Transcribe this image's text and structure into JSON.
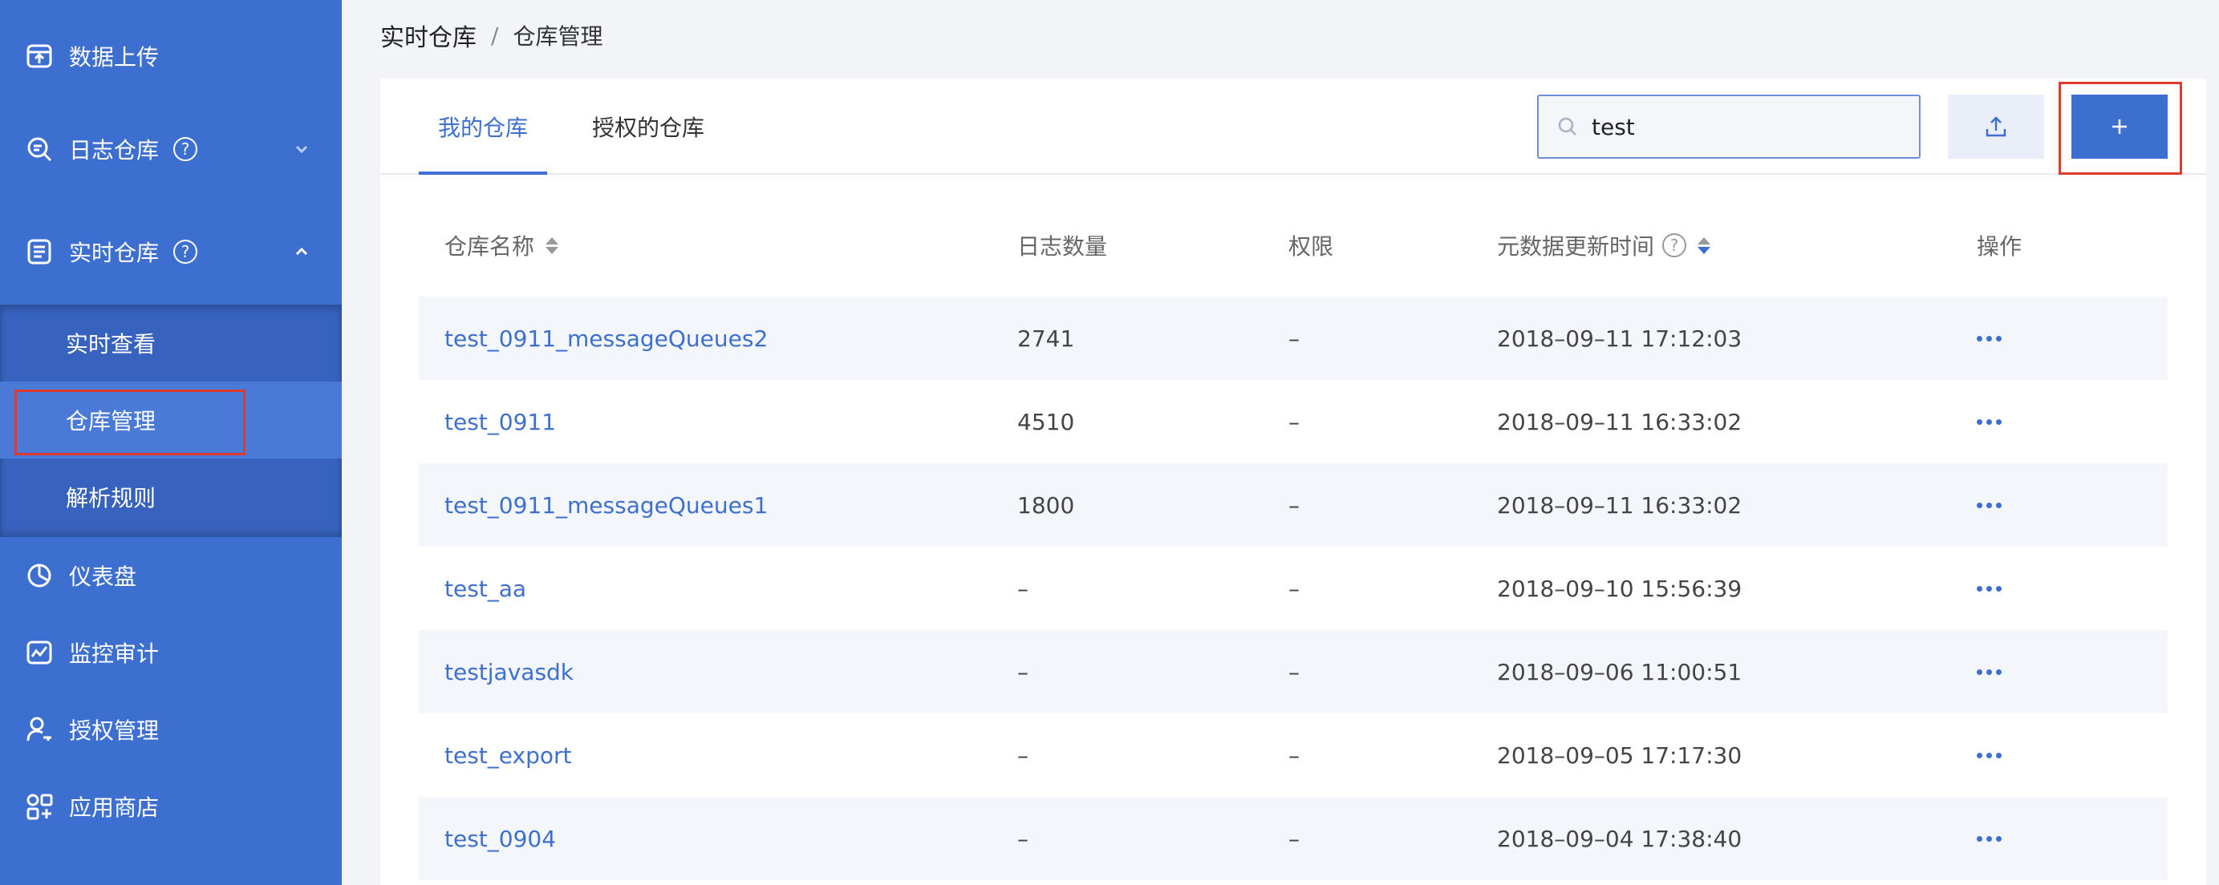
{
  "sidebar": {
    "items": [
      {
        "label": "数据上传",
        "icon": "upload-doc-icon"
      },
      {
        "label": "日志仓库",
        "icon": "log-search-icon",
        "help": "?"
      },
      {
        "label": "实时仓库",
        "icon": "list-doc-icon",
        "help": "?"
      },
      {
        "label": "仪表盘",
        "icon": "pie-chart-icon"
      },
      {
        "label": "监控审计",
        "icon": "monitor-chart-icon"
      },
      {
        "label": "授权管理",
        "icon": "user-key-icon"
      },
      {
        "label": "应用商店",
        "icon": "app-store-icon"
      }
    ],
    "submenu": [
      {
        "label": "实时查看"
      },
      {
        "label": "仓库管理"
      },
      {
        "label": "解析规则"
      }
    ]
  },
  "breadcrumb": {
    "parent": "实时仓库",
    "separator": "/",
    "current": "仓库管理"
  },
  "tabs": [
    {
      "label": "我的仓库"
    },
    {
      "label": "授权的仓库"
    }
  ],
  "search": {
    "value": "test"
  },
  "table": {
    "headers": {
      "name": "仓库名称",
      "count": "日志数量",
      "perm": "权限",
      "updated": "元数据更新时间",
      "help": "?",
      "ops": "操作"
    },
    "rows": [
      {
        "name": "test_0911_messageQueues2",
        "count": "2741",
        "perm": "–",
        "updated": "2018–09–11 17:12:03"
      },
      {
        "name": "test_0911",
        "count": "4510",
        "perm": "–",
        "updated": "2018–09–11 16:33:02"
      },
      {
        "name": "test_0911_messageQueues1",
        "count": "1800",
        "perm": "–",
        "updated": "2018–09–11 16:33:02"
      },
      {
        "name": "test_aa",
        "count": "–",
        "perm": "–",
        "updated": "2018–09–10 15:56:39"
      },
      {
        "name": "testjavasdk",
        "count": "–",
        "perm": "–",
        "updated": "2018–09–06 11:00:51"
      },
      {
        "name": "test_export",
        "count": "–",
        "perm": "–",
        "updated": "2018–09–05 17:17:30"
      },
      {
        "name": "test_0904",
        "count": "–",
        "perm": "–",
        "updated": "2018–09–04 17:38:40"
      }
    ]
  },
  "colors": {
    "accent": "#3d6fd1",
    "sidebar": "#3d6fd1",
    "highlight": "#e03a2f"
  }
}
